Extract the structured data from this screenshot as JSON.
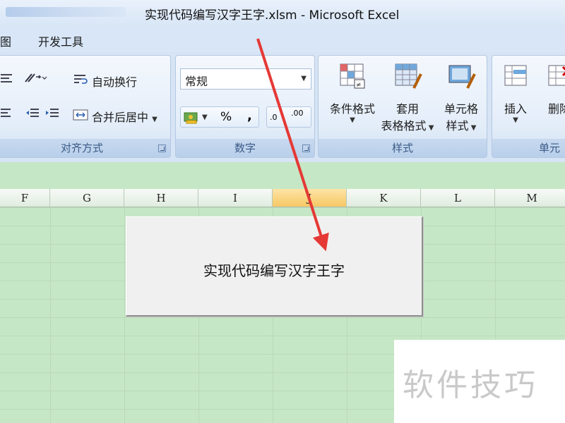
{
  "window": {
    "title": "实现代码编写汉字王字.xlsm - Microsoft Excel"
  },
  "menu": {
    "items": [
      {
        "label": "图"
      },
      {
        "label": "开发工具"
      }
    ]
  },
  "ribbon": {
    "alignment": {
      "wrap_text": "自动换行",
      "merge_center": "合并后居中",
      "label": "对齐方式"
    },
    "number": {
      "format_value": "常规",
      "percent": "%",
      "comma": ",",
      "increase_decimal": ".0",
      "decrease_decimal": ".00",
      "label": "数字"
    },
    "styles": {
      "conditional": "条件格式",
      "table_format_line1": "套用",
      "table_format_line2": "表格格式",
      "cell_style_line1": "单元格",
      "cell_style_line2": "样式",
      "label": "样式"
    },
    "cells": {
      "insert": "插入",
      "delete": "删除",
      "label": "单元"
    }
  },
  "sheet": {
    "columns": [
      "F",
      "G",
      "H",
      "I",
      "J",
      "K",
      "L",
      "M"
    ],
    "active_column": "J"
  },
  "macro_button": {
    "label": "实现代码编写汉字王字"
  },
  "watermark": {
    "text": "软件技巧"
  },
  "colors": {
    "sheet_background": "#c6e7c6",
    "arrow": "#e53935",
    "active_header": "#f6c865"
  }
}
